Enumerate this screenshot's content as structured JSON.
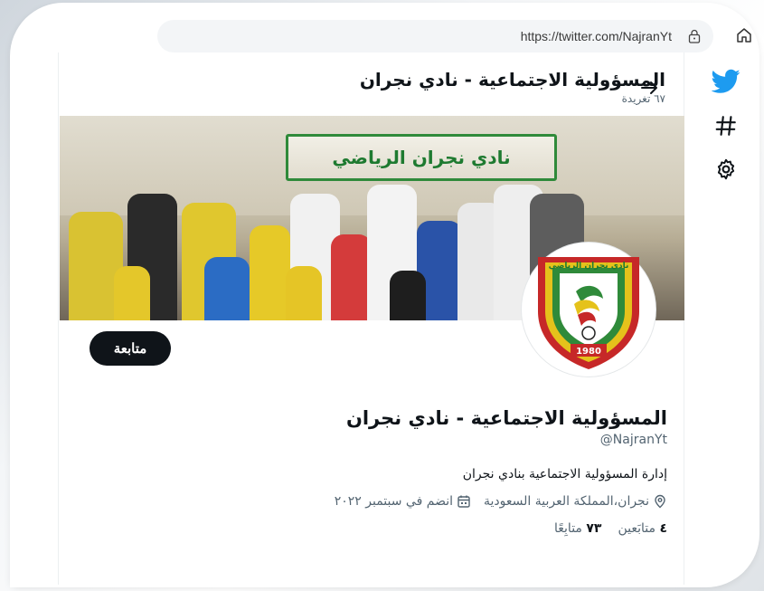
{
  "browser": {
    "url": "https://twitter.com/NajranYt"
  },
  "header": {
    "title": "المسؤولية الاجتماعية - نادي نجران",
    "tweet_count": "٦٧ تغريدة"
  },
  "banner": {
    "sign_text": "نادي نجران الرياضي"
  },
  "avatar": {
    "club_name": "نادي نجران الرياضي",
    "year": "1980"
  },
  "profile": {
    "follow_label": "متابعة",
    "name": "المسؤولية الاجتماعية - نادي نجران",
    "handle": "@NajranYt",
    "bio": "إدارة المسؤولية الاجتماعية بنادي نجران",
    "location": "نجران،المملكة العربية السعودية",
    "joined": "انضم في سبتمبر ٢٠٢٢",
    "following_count": "٤",
    "following_label": "متابَعين",
    "followers_count": "٧٣",
    "followers_label": "متابِعًا"
  },
  "colors": {
    "twitter_blue": "#1d9bf0",
    "club_green": "#2f8a3a",
    "club_yellow": "#e5c21b",
    "club_red": "#c62828"
  },
  "icons": [
    "home-icon",
    "lock-icon",
    "twitter-logo-icon",
    "hashtag-icon",
    "settings-icon",
    "back-arrow-icon",
    "location-icon",
    "calendar-icon"
  ]
}
